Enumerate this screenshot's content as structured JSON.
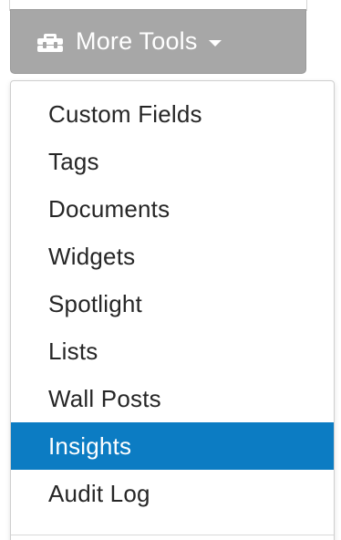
{
  "button": {
    "label": "More Tools",
    "icon": "toolbox-icon",
    "caret_icon": "caret-down-icon",
    "background": "#a7a7a7",
    "text_color": "#ffffff"
  },
  "menu": {
    "items": [
      {
        "label": "Custom Fields",
        "active": false
      },
      {
        "label": "Tags",
        "active": false
      },
      {
        "label": "Documents",
        "active": false
      },
      {
        "label": "Widgets",
        "active": false
      },
      {
        "label": "Spotlight",
        "active": false
      },
      {
        "label": "Lists",
        "active": false
      },
      {
        "label": "Wall Posts",
        "active": false
      },
      {
        "label": "Insights",
        "active": true
      },
      {
        "label": "Audit Log",
        "active": false
      }
    ],
    "active_color": "#0c7cc3"
  }
}
